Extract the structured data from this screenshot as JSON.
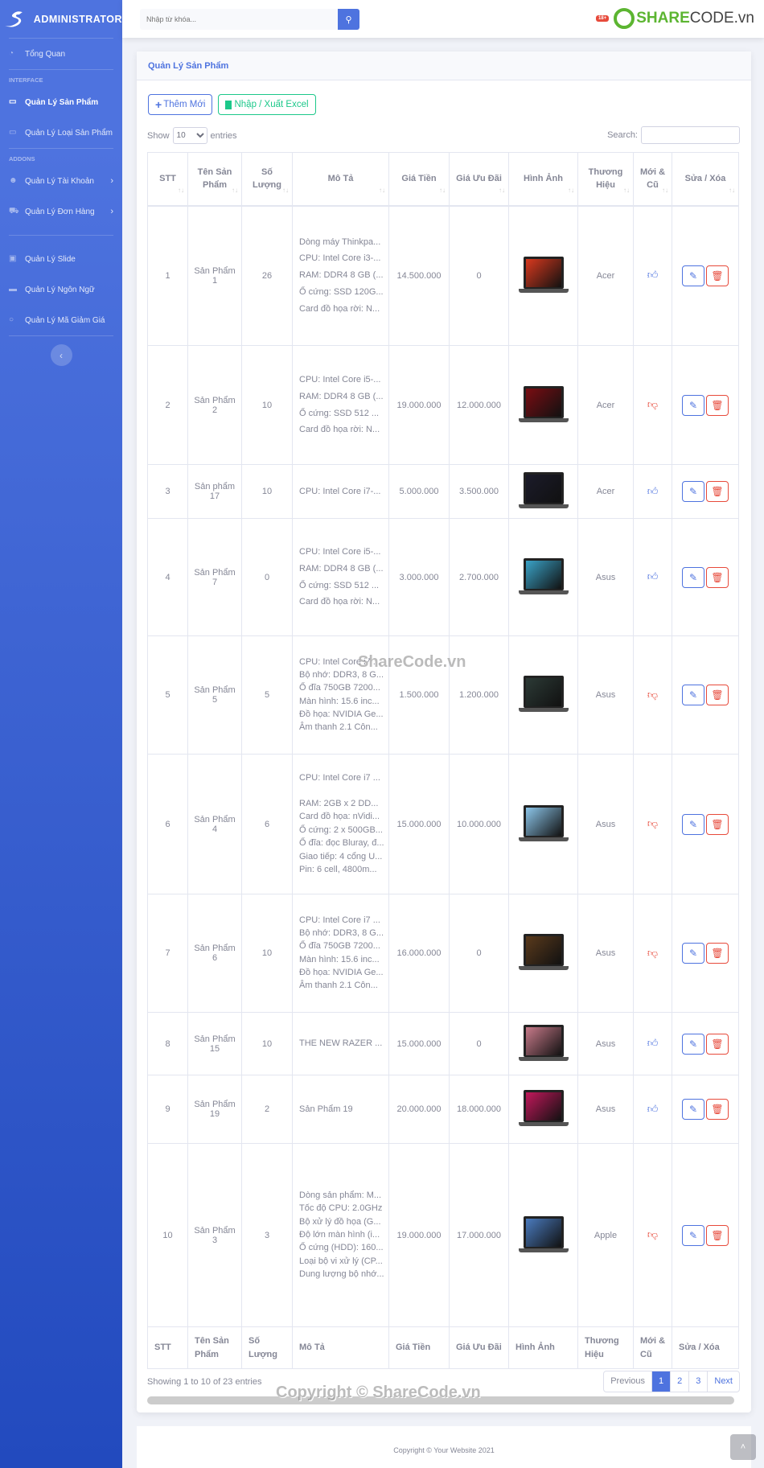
{
  "sidebar": {
    "brand": "ADMINISTRATOR",
    "sections": {
      "interface": "INTERFACE",
      "addons": "ADDONS"
    },
    "items": [
      {
        "label": "Tổng Quan",
        "icon": "dashboard-icon"
      },
      {
        "label": "Quản Lý Sản Phẩm",
        "icon": "laptop-icon",
        "active": true
      },
      {
        "label": "Quản Lý Loại Sản Phẩm",
        "icon": "laptop-icon"
      },
      {
        "label": "Quản Lý Tài Khoản",
        "icon": "users-icon",
        "chevron": true
      },
      {
        "label": "Quản Lý Đơn Hàng",
        "icon": "cart-icon",
        "chevron": true
      },
      {
        "label": "Quản Lý Slide",
        "icon": "slide-icon"
      },
      {
        "label": "Quản Lý Ngôn Ngữ",
        "icon": "language-icon"
      },
      {
        "label": "Quản Lý Mã Giảm Giá",
        "icon": "coupon-icon"
      }
    ],
    "toggle_icon": "chevron-left-icon"
  },
  "topbar": {
    "search_placeholder": "Nhập từ khóa...",
    "logo_badge": "18+",
    "logo_text_a": "SHARE",
    "logo_text_b": "CODE.vn"
  },
  "card": {
    "title": "Quản Lý Sản Phẩm",
    "add_label": "Thêm Mới",
    "excel_label": "Nhập / Xuất Excel",
    "show_label": "Show",
    "entries_label": "entries",
    "page_length": "10",
    "search_label": "Search:"
  },
  "table": {
    "headers": [
      "STT",
      "Tên Sản Phẩm",
      "Số Lượng",
      "Mô Tả",
      "Giá Tiền",
      "Giá Ưu Đãi",
      "Hình Ảnh",
      "Thương Hiệu",
      "Mới & Cũ",
      "Sửa / Xóa"
    ],
    "rows": [
      {
        "stt": "1",
        "name": "Sản Phẩm 1",
        "qty": "26",
        "desc": [
          "Dòng máy Thinkpa...",
          "CPU: Intel Core i3-...",
          "RAM: DDR4 8 GB (...",
          "Ổ cứng: SSD 120G...",
          "Card đồ họa rời: N..."
        ],
        "price": "14.500.000",
        "sale": "0",
        "brand": "Acer",
        "new": true,
        "screen": "#d9391e"
      },
      {
        "stt": "2",
        "name": "Sản Phẩm 2",
        "qty": "10",
        "desc": [
          "CPU: Intel Core i5-...",
          "RAM: DDR4 8 GB (...",
          "Ổ cứng: SSD 512 ...",
          "Card đồ họa rời: N..."
        ],
        "price": "19.000.000",
        "sale": "12.000.000",
        "brand": "Acer",
        "new": false,
        "screen": "#7a0d12"
      },
      {
        "stt": "3",
        "name": "Sản phẩm 17",
        "qty": "10",
        "desc": [
          "CPU: Intel Core i7-..."
        ],
        "price": "5.000.000",
        "sale": "3.500.000",
        "brand": "Acer",
        "new": true,
        "screen": "#1b1b2a"
      },
      {
        "stt": "4",
        "name": "Sản Phẩm 7",
        "qty": "0",
        "desc": [
          "CPU: Intel Core i5-...",
          "RAM: DDR4 8 GB (...",
          "Ổ cứng: SSD 512 ...",
          "Card đồ họa rời: N..."
        ],
        "price": "3.000.000",
        "sale": "2.700.000",
        "brand": "Asus",
        "new": true,
        "screen": "#3aa3c8"
      },
      {
        "stt": "5",
        "name": "Sản Phẩm 5",
        "qty": "5",
        "desc": [
          "CPU: Intel Core i7 ...",
          "Bộ nhớ: DDR3, 8 G...",
          "Ổ đĩa 750GB 7200...",
          "Màn hình: 15.6 inc...",
          "Đồ họa: NVIDIA Ge...",
          "Âm thanh 2.1 Côn..."
        ],
        "price": "1.500.000",
        "sale": "1.200.000",
        "brand": "Asus",
        "new": false,
        "screen": "#2c3a36"
      },
      {
        "stt": "6",
        "name": "Sản Phẩm 4",
        "qty": "6",
        "desc": [
          "CPU: Intel Core i7 ...",
          "",
          "RAM: 2GB x 2 DD...",
          "Card đồ họa: nVidi...",
          "Ổ cứng: 2 x 500GB...",
          "Ổ đĩa: đọc Bluray, đ...",
          "Giao tiếp: 4 cổng U...",
          "Pin: 6 cell, 4800m..."
        ],
        "price": "15.000.000",
        "sale": "10.000.000",
        "brand": "Asus",
        "new": false,
        "screen": "#8cc6ea"
      },
      {
        "stt": "7",
        "name": "Sản Phẩm 6",
        "qty": "10",
        "desc": [
          "CPU: Intel Core i7 ...",
          "Bộ nhớ: DDR3, 8 G...",
          "Ổ đĩa 750GB 7200...",
          "Màn hình: 15.6 inc...",
          "Đồ họa: NVIDIA Ge...",
          "Âm thanh 2.1 Côn..."
        ],
        "price": "16.000.000",
        "sale": "0",
        "brand": "Asus",
        "new": false,
        "screen": "#5a3a1c"
      },
      {
        "stt": "8",
        "name": "Sản Phẩm 15",
        "qty": "10",
        "desc": [
          "THE NEW RAZER ..."
        ],
        "price": "15.000.000",
        "sale": "0",
        "brand": "Asus",
        "new": true,
        "screen": "#c87a8a"
      },
      {
        "stt": "9",
        "name": "Sản Phẩm 19",
        "qty": "2",
        "desc": [
          "Sản Phẩm 19"
        ],
        "price": "20.000.000",
        "sale": "18.000.000",
        "brand": "Asus",
        "new": true,
        "screen": "#c2185b"
      },
      {
        "stt": "10",
        "name": "Sản Phẩm 3",
        "qty": "3",
        "desc": [
          "Dòng sản phẩm: M...",
          "Tốc độ CPU: 2.0GHz",
          "Bộ xử lý đồ họa (G...",
          "Độ lớn màn hình (i...",
          "Ổ cứng (HDD): 160...",
          "Loại bộ vi xử lý (CP...",
          "Dung lượng bộ nhớ..."
        ],
        "price": "19.000.000",
        "sale": "17.000.000",
        "brand": "Apple",
        "new": false,
        "screen": "#4a7bbf"
      }
    ]
  },
  "pagination": {
    "info": "Showing 1 to 10 of 23 entries",
    "previous": "Previous",
    "pages": [
      "1",
      "2",
      "3"
    ],
    "current": "1",
    "next": "Next"
  },
  "footer": {
    "copyright": "Copyright © Your Website 2021"
  },
  "watermarks": [
    "ShareCode.vn",
    "Copyright © ShareCode.vn"
  ],
  "colors": {
    "primary": "#4e73df",
    "success": "#1cc88a",
    "danger": "#e74a3b"
  }
}
